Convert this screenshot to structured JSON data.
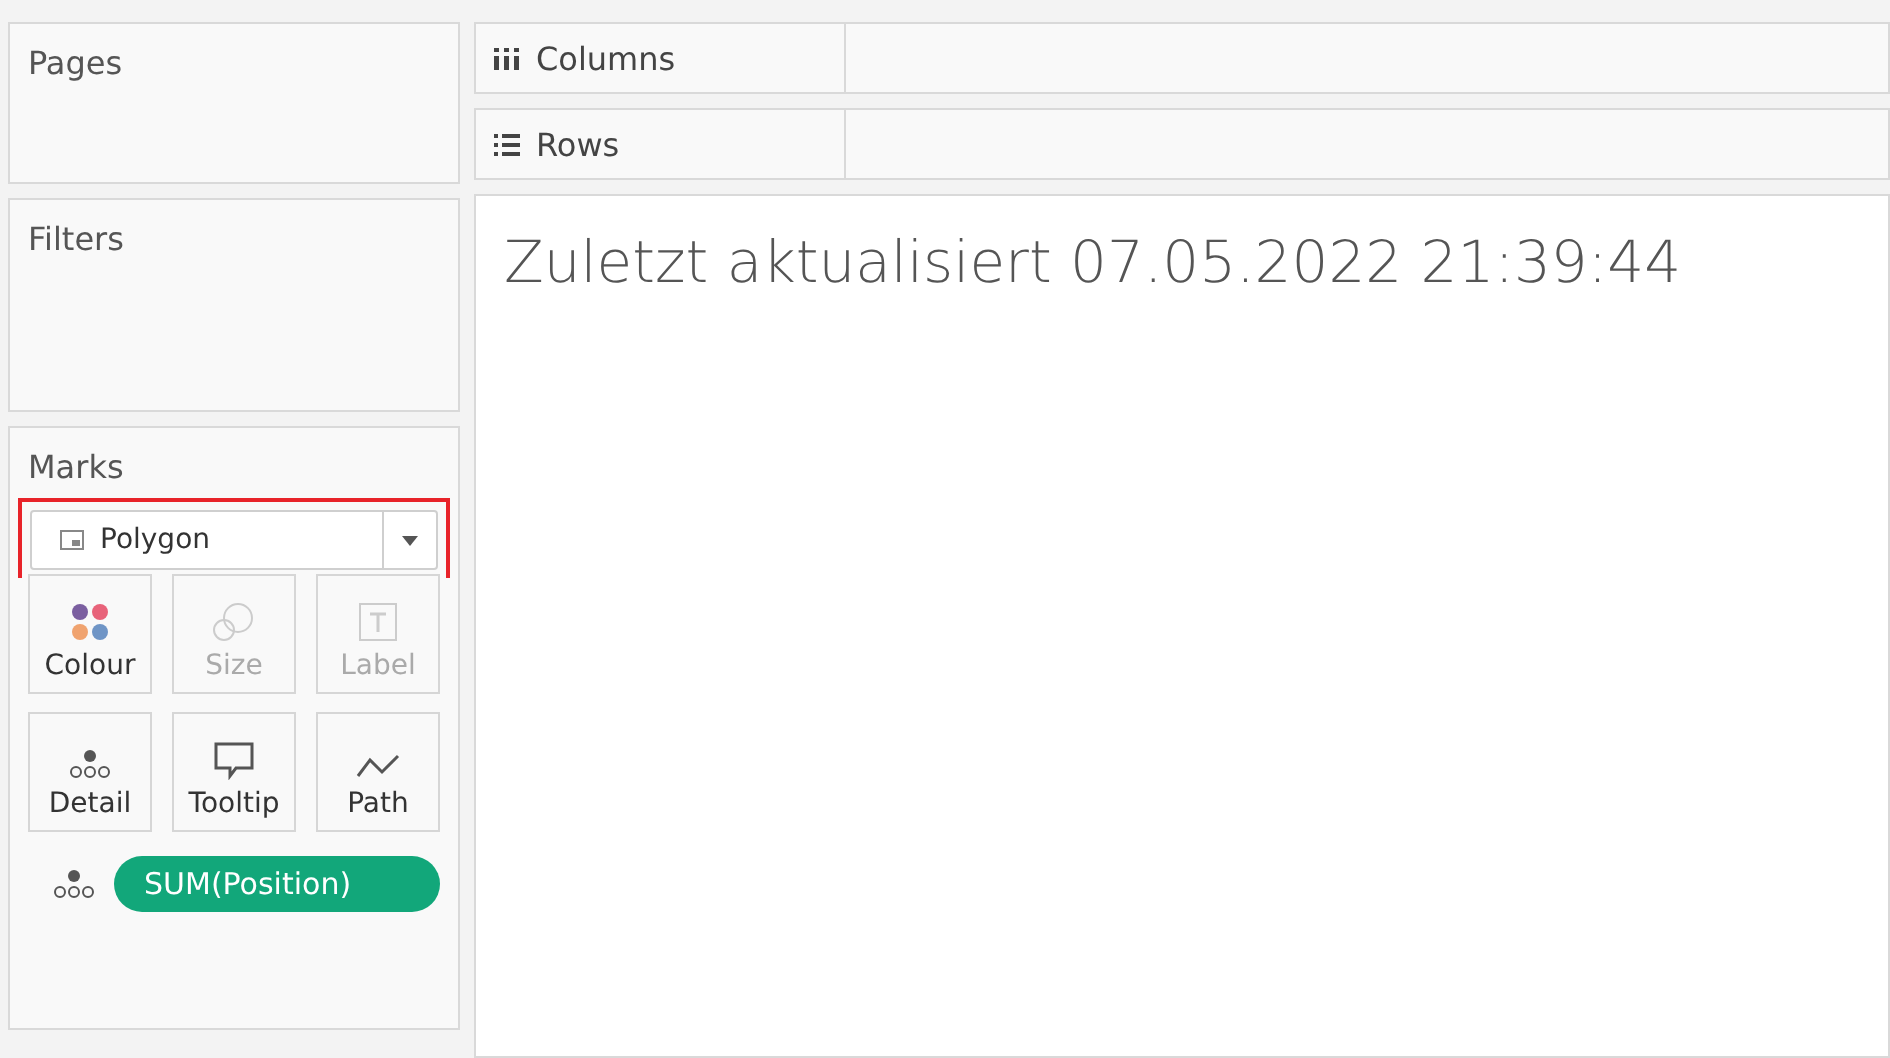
{
  "cards": {
    "pages": {
      "title": "Pages"
    },
    "filters": {
      "title": "Filters"
    }
  },
  "marks": {
    "title": "Marks",
    "mark_type": {
      "label": "Polygon",
      "highlighted": true
    },
    "buttons": [
      {
        "kind": "colour",
        "label": "Colour",
        "disabled": false
      },
      {
        "kind": "size",
        "label": "Size",
        "disabled": true
      },
      {
        "kind": "label",
        "label": "Label",
        "disabled": true
      },
      {
        "kind": "detail",
        "label": "Detail",
        "disabled": false
      },
      {
        "kind": "tooltip",
        "label": "Tooltip",
        "disabled": false
      },
      {
        "kind": "path",
        "label": "Path",
        "disabled": false
      }
    ],
    "pills": [
      {
        "kind": "detail",
        "label": "SUM(Position)"
      }
    ]
  },
  "shelves": [
    {
      "kind": "columns",
      "label": "Columns"
    },
    {
      "kind": "rows",
      "label": "Rows"
    }
  ],
  "view": {
    "title": "Zuletzt aktualisiert 07.05.2022 21:39:44"
  }
}
